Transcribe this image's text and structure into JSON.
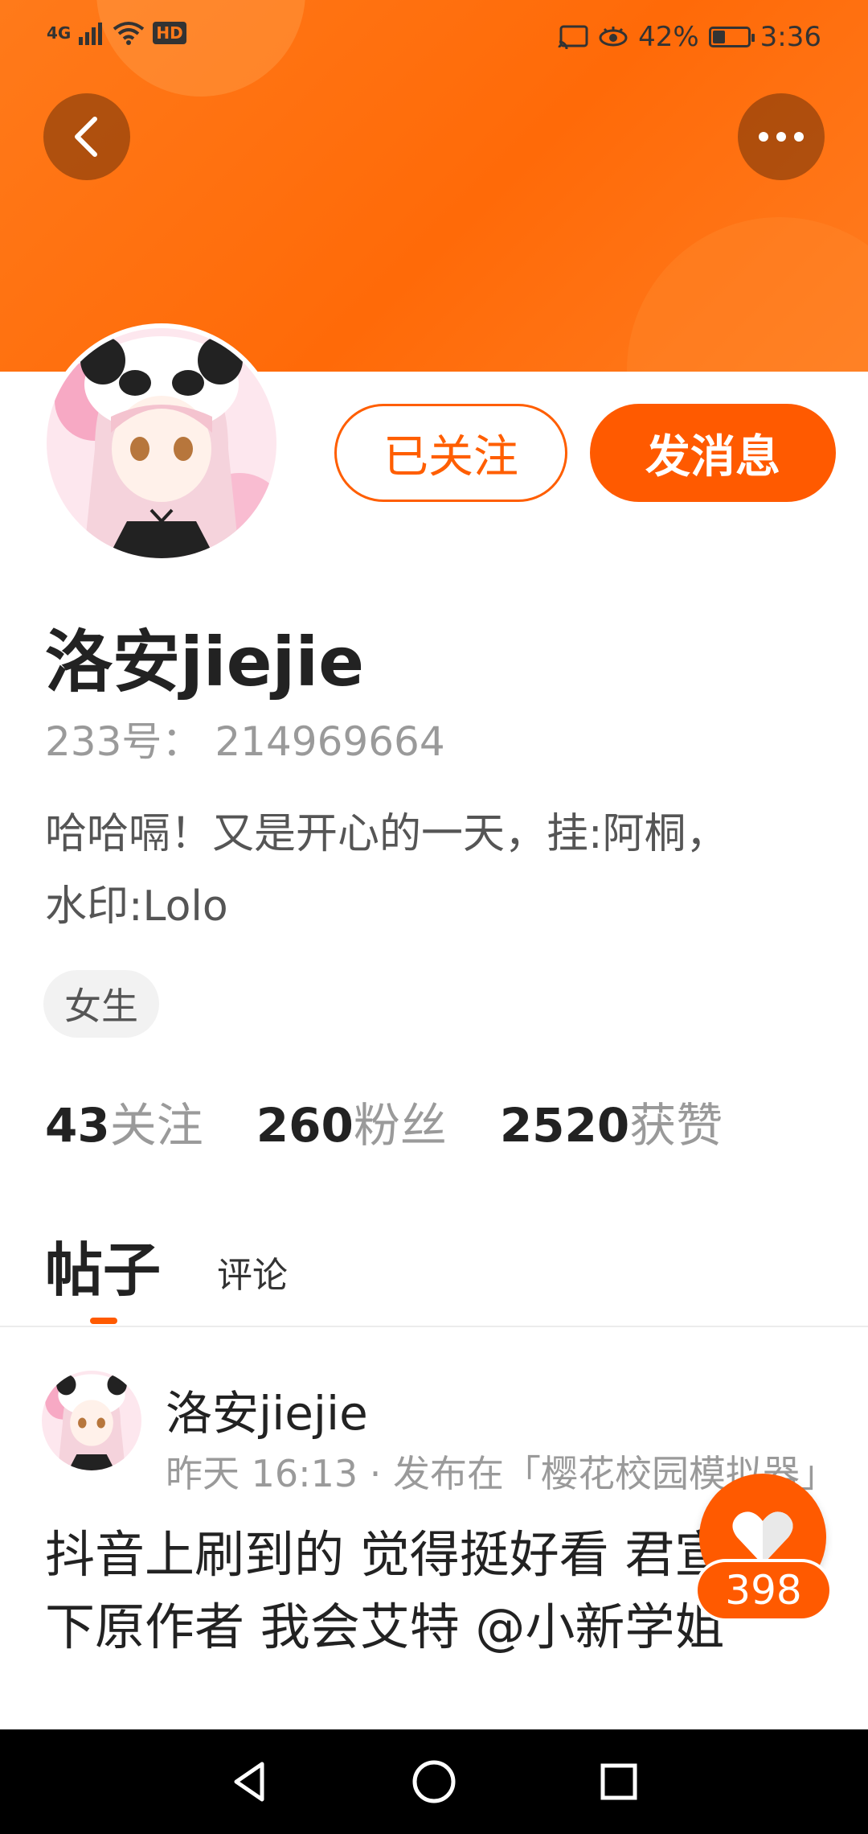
{
  "status_bar": {
    "network": "4G",
    "hd": "HD",
    "battery_percent": "42%",
    "battery_level": 0.42,
    "time": "3:36"
  },
  "profile": {
    "follow_button": "已关注",
    "message_button": "发消息",
    "name": "洛安jiejie",
    "id_line": "233号： 214969664",
    "bio": "哈哈嗝！又是开心的一天，挂:阿桐，水印:Lolo",
    "gender_tag": "女生"
  },
  "stats": [
    {
      "num": "43",
      "label": "关注"
    },
    {
      "num": "260",
      "label": "粉丝"
    },
    {
      "num": "2520",
      "label": "获赞"
    }
  ],
  "tabs": {
    "posts": "帖子",
    "comments": "评论"
  },
  "post": {
    "author": "洛安jiejie",
    "meta": "昨天 16:13 · 发布在「樱花校园模拟器」",
    "text": "抖音上刷到的 觉得挺好看 君宣传一下原作者 我会艾特 @小新学姐",
    "like_count": "398"
  },
  "colors": {
    "accent": "#ff5a00",
    "header": "#ff7a1a"
  },
  "icons": [
    "back-arrow-icon",
    "more-icon",
    "heart-icon",
    "nav-back-icon",
    "nav-home-icon",
    "nav-recents-icon"
  ]
}
